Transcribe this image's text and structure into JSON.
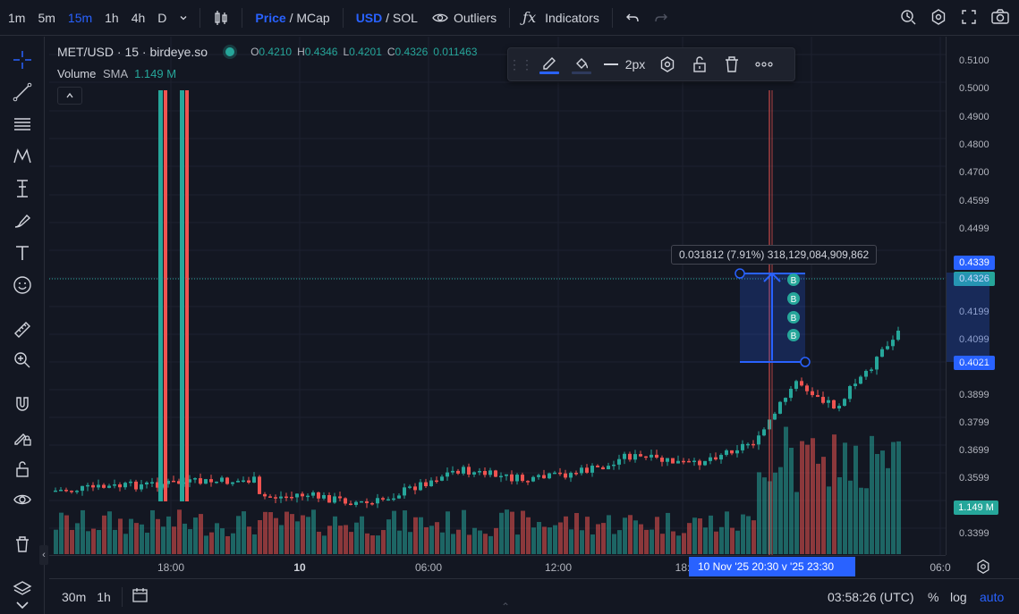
{
  "toolbar": {
    "timeframes": [
      "1m",
      "5m",
      "15m",
      "1h",
      "4h",
      "D"
    ],
    "active_timeframe": "15m",
    "price_label": "Price",
    "mcap_label": "/ MCap",
    "usd_label": "USD",
    "sol_label": "/ SOL",
    "outliers_label": "Outliers",
    "indicators_label": "Indicators"
  },
  "legend": {
    "symbol": "MET/USD · 15 · birdeye.so",
    "o_label": "O",
    "o": "0.4210",
    "h_label": "H",
    "h": "0.4346",
    "l_label": "L",
    "l": "0.4201",
    "c_label": "C",
    "c": "0.4326",
    "change": "0.011463",
    "volume_label": "Volume",
    "sma_label": "SMA",
    "volume_value": "1.149 M"
  },
  "float_toolbar": {
    "width_label": "2px"
  },
  "measure": {
    "text": "0.031812 (7.91%) 318,129,084,909,862"
  },
  "price_axis": {
    "labels": [
      "0.5100",
      "0.5000",
      "0.4900",
      "0.4800",
      "0.4700",
      "0.4599",
      "0.4499",
      "0.4199",
      "0.4099",
      "0.3899",
      "0.3799",
      "0.3699",
      "0.3599",
      "0.3399"
    ],
    "tag_high": "0.4339",
    "tag_last": "0.4326",
    "tag_low": "0.4021",
    "tag_volume": "1.149 M"
  },
  "time_axis": {
    "labels": [
      "18:00",
      "10",
      "06:00",
      "12:00",
      "18:",
      "06:0"
    ],
    "crosshair_time": "10 Nov '25  20:30  v '25  23:30"
  },
  "bottom": {
    "range_buttons": [
      "30m",
      "1h"
    ],
    "clock": "03:58:26 (UTC)",
    "percent": "%",
    "log": "log",
    "auto": "auto"
  },
  "colors": {
    "up": "#26a69a",
    "down": "#ef5350",
    "accent": "#2962ff",
    "bg": "#131722"
  }
}
